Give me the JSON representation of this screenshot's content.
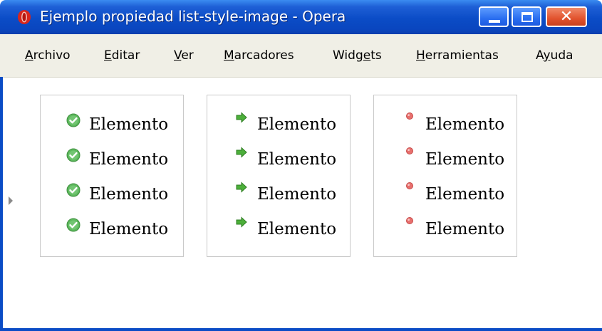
{
  "window": {
    "title": "Ejemplo propiedad list-style-image - Opera"
  },
  "menu": [
    {
      "label": "Archivo",
      "mnemonic_index": 0
    },
    {
      "label": "Editar",
      "mnemonic_index": 0
    },
    {
      "label": "Ver",
      "mnemonic_index": 0
    },
    {
      "label": "Marcadores",
      "mnemonic_index": 0
    },
    {
      "label": "Widgets",
      "mnemonic_index": 4
    },
    {
      "label": "Herramientas",
      "mnemonic_index": 0
    },
    {
      "label": "Ayuda",
      "mnemonic_index": 1
    }
  ],
  "lists": [
    {
      "marker_icon": "green-check-icon",
      "marker_color": "#5cb85c",
      "items": [
        "Elemento",
        "Elemento",
        "Elemento",
        "Elemento"
      ]
    },
    {
      "marker_icon": "green-arrow-icon",
      "marker_color": "#4caf3a",
      "items": [
        "Elemento",
        "Elemento",
        "Elemento",
        "Elemento"
      ]
    },
    {
      "marker_icon": "red-dot-icon",
      "marker_color": "#e8706e",
      "items": [
        "Elemento",
        "Elemento",
        "Elemento",
        "Elemento"
      ]
    }
  ]
}
